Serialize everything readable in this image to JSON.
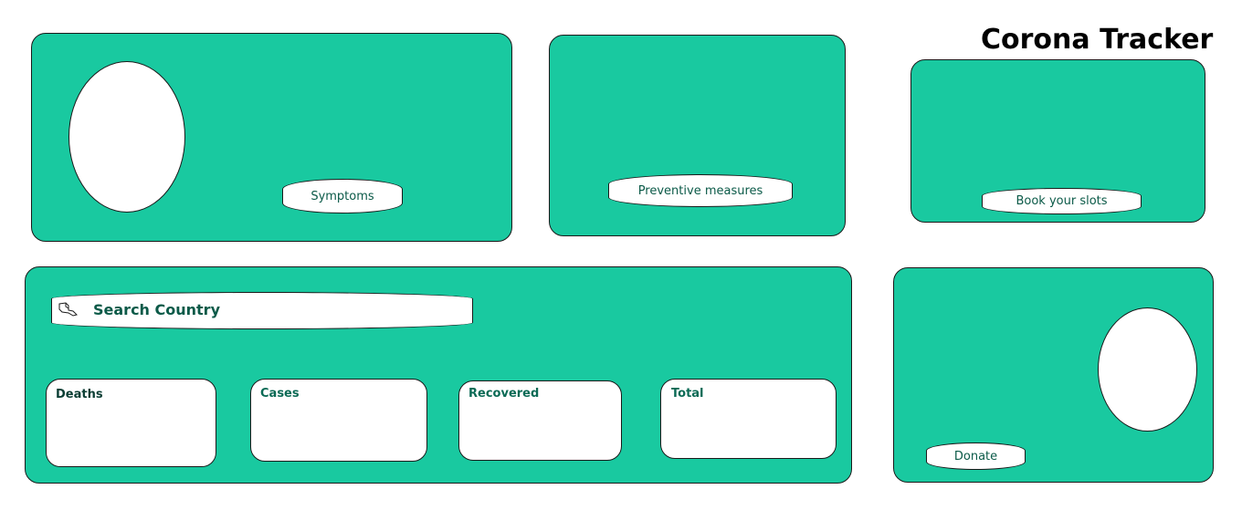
{
  "app": {
    "title": "Corona Tracker"
  },
  "symptoms_card": {
    "button_label": "Symptoms"
  },
  "preventive_card": {
    "button_label": "Preventive measures"
  },
  "slots_card": {
    "button_label": "Book your slots"
  },
  "search": {
    "label": "Search Country",
    "icon": "search-icon"
  },
  "stats": [
    {
      "label": "Deaths",
      "value": ""
    },
    {
      "label": "Cases",
      "value": ""
    },
    {
      "label": "Recovered",
      "value": ""
    },
    {
      "label": "Total",
      "value": ""
    }
  ],
  "donate_card": {
    "button_label": "Donate"
  },
  "colors": {
    "card_bg": "#19c9a0",
    "text_accent": "#0b5a48",
    "border": "#1a1a1a"
  }
}
